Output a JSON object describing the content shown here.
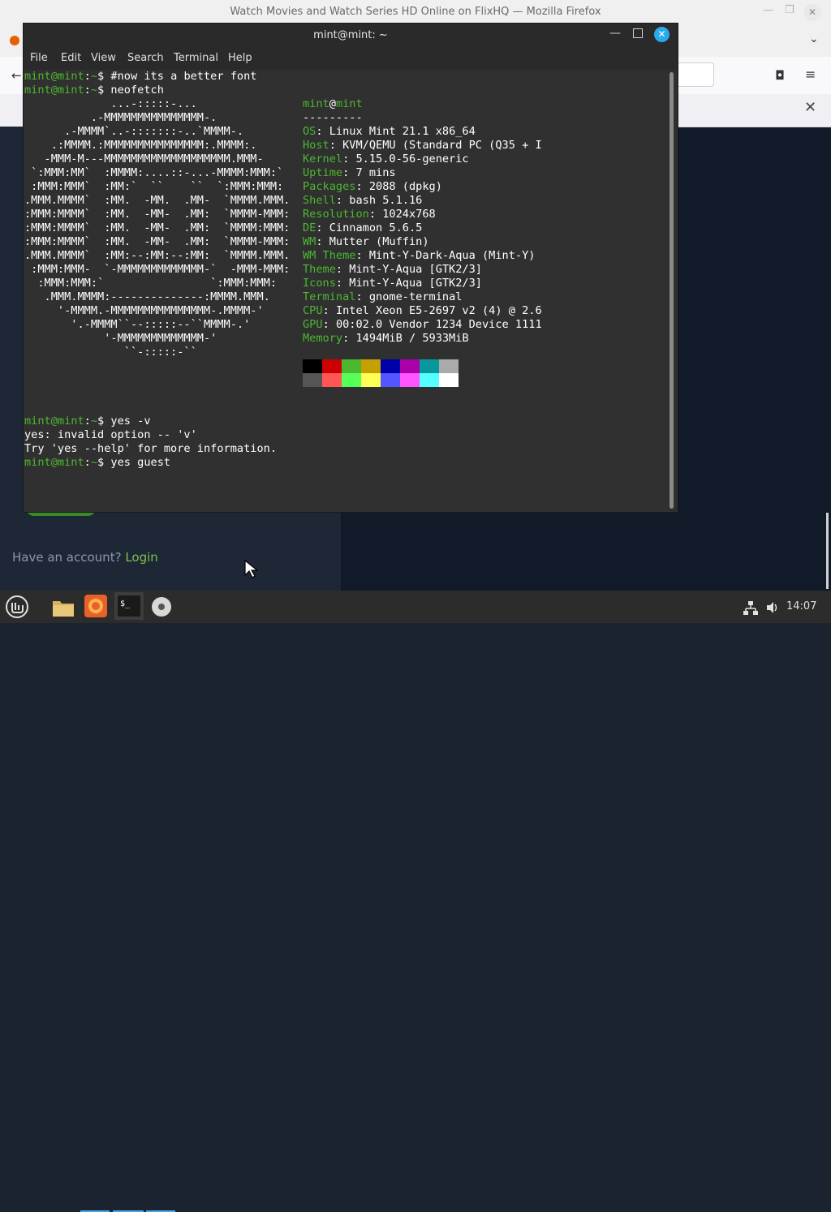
{
  "firefox": {
    "title": "Watch Movies and Watch Series HD Online on FlixHQ — Mozilla Firefox",
    "account_text": "Have an account?",
    "login_link": "Login"
  },
  "terminal": {
    "title": "mint@mint: ~",
    "menu": [
      "File",
      "Edit",
      "Search",
      "Terminal",
      "Help",
      "View"
    ],
    "prompt_user": "mint@mint",
    "prompt_sep": ":",
    "prompt_path": "~",
    "prompt_dollar": "$",
    "commands": [
      "#now its a better font",
      "neofetch",
      "yes -v",
      "yes guest"
    ],
    "output": [
      "yes: invalid option -- 'v'",
      "Try 'yes --help' for more information."
    ],
    "neofetch": {
      "user": "mint",
      "at": "@",
      "host": "mint",
      "separator": "---------",
      "fields": [
        {
          "key": "OS",
          "value": "Linux Mint 21.1 x86_64"
        },
        {
          "key": "Host",
          "value": "KVM/QEMU (Standard PC (Q35 + I"
        },
        {
          "key": "Kernel",
          "value": "5.15.0-56-generic"
        },
        {
          "key": "Uptime",
          "value": "7 mins"
        },
        {
          "key": "Packages",
          "value": "2088 (dpkg)"
        },
        {
          "key": "Shell",
          "value": "bash 5.1.16"
        },
        {
          "key": "Resolution",
          "value": "1024x768"
        },
        {
          "key": "DE",
          "value": "Cinnamon 5.6.5"
        },
        {
          "key": "WM",
          "value": "Mutter (Muffin)"
        },
        {
          "key": "WM Theme",
          "value": "Mint-Y-Dark-Aqua (Mint-Y)"
        },
        {
          "key": "Theme",
          "value": "Mint-Y-Aqua [GTK2/3]"
        },
        {
          "key": "Icons",
          "value": "Mint-Y-Aqua [GTK2/3]"
        },
        {
          "key": "Terminal",
          "value": "gnome-terminal"
        },
        {
          "key": "CPU",
          "value": "Intel Xeon E5-2697 v2 (4) @ 2.6"
        },
        {
          "key": "GPU",
          "value": "00:02.0 Vendor 1234 Device 1111"
        },
        {
          "key": "Memory",
          "value": "1494MiB / 5933MiB"
        }
      ],
      "palette_top": [
        "#000000",
        "#cc0000",
        "#4cb830",
        "#c4a000",
        "#0000aa",
        "#aa00aa",
        "#06989a",
        "#aaaaaa"
      ],
      "palette_bottom": [
        "#555555",
        "#ff5555",
        "#55ff55",
        "#ffff55",
        "#5555ff",
        "#ff55ff",
        "#55ffff",
        "#ffffff"
      ],
      "logo": [
        [
          "",
          "             ...-:::::-..."
        ],
        [
          "",
          "          .-MMMMMMMMMMMMMMM-."
        ],
        [
          "",
          "      .-MMMM`..-:::::::-..`MMMM-."
        ],
        [
          "",
          "    .:MMMM.:MMMMMMMMMMMMMMM:.MMMM:."
        ],
        [
          "",
          "   -MMM-M---MMMMMMMMMMMMMMMMMMM.MMM-"
        ],
        [
          "",
          " `:MMM:MM`  :MMMM:....::-...-MMMM:MMM:`"
        ],
        [
          "",
          " :MMM:MMM`  :MM:`  ``    ``  `:MMM:MMM:"
        ],
        [
          "",
          ".MMM.MMMM`  :MM.  -MM.  .MM-  `MMMM.MMM."
        ],
        [
          "",
          ":MMM:MMMM`  :MM.  -MM-  .MM:  `MMMM-MMM:"
        ],
        [
          "",
          ":MMM:MMMM`  :MM.  -MM-  .MM:  `MMMM:MMM:"
        ],
        [
          "",
          ":MMM:MMMM`  :MM.  -MM-  .MM:  `MMMM-MMM:"
        ],
        [
          "",
          ".MMM.MMMM`  :MM:--:MM:--:MM:  `MMMM.MMM."
        ],
        [
          "",
          " :MMM:MMM-  `-MMMMMMMMMMMMM-`  -MMM-MMM:"
        ],
        [
          "",
          "  :MMM:MMM:`                `:MMM:MMM:"
        ],
        [
          "",
          "   .MMM.MMMM:--------------:MMMM.MMM."
        ],
        [
          "",
          "     '-MMMM.-MMMMMMMMMMMMMMM-.MMMM-'"
        ],
        [
          "",
          "       '.-MMMM``--:::::--``MMMM-.'"
        ],
        [
          "",
          "            '-MMMMMMMMMMMMM-'"
        ],
        [
          "",
          "               ``-:::::-``"
        ]
      ]
    }
  },
  "taskbar": {
    "clock": "14:07"
  }
}
